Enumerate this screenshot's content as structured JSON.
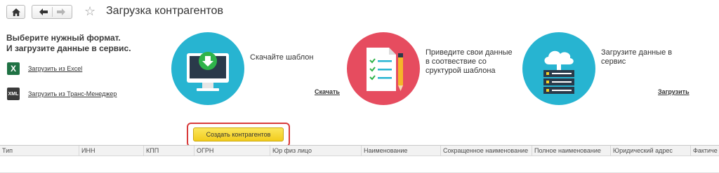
{
  "page": {
    "title": "Загрузка контрагентов"
  },
  "intro": {
    "line1": "Выберите нужный формат.",
    "line2": "И загрузите данные в сервис."
  },
  "links": {
    "excel": {
      "label": "Загрузить из Excel",
      "icon": "excel-icon",
      "icon_text": "X"
    },
    "trans": {
      "label": "Загрузить из Транс-Менеджер",
      "icon": "xml-icon",
      "icon_text": "XML"
    }
  },
  "steps": [
    {
      "text_line1": "Скачайте шаблон",
      "text_line2": "",
      "text_line3": "",
      "link": "Скачать"
    },
    {
      "text_line1": "Приведите свои данные",
      "text_line2": "в соотвествие со",
      "text_line3": "сруктурой шаблона",
      "link": ""
    },
    {
      "text_line1": "Загрузите данные в",
      "text_line2": "сервис",
      "text_line3": "",
      "link": "Загрузить"
    }
  ],
  "create_button": {
    "label": "Создать контрагентов"
  },
  "colors": {
    "accent_blue": "#27b4d1",
    "accent_red": "#e64c5f",
    "button_yellow": "#f5d327",
    "focus_red": "#d83a3a"
  },
  "table": {
    "columns": [
      "Тип",
      "ИНН",
      "КПП",
      "ОГРН",
      "Юр физ лицо",
      "Наименование",
      "Сокращенное наименование",
      "Полное наименование",
      "Юридический адрес",
      "Фактиче"
    ]
  }
}
